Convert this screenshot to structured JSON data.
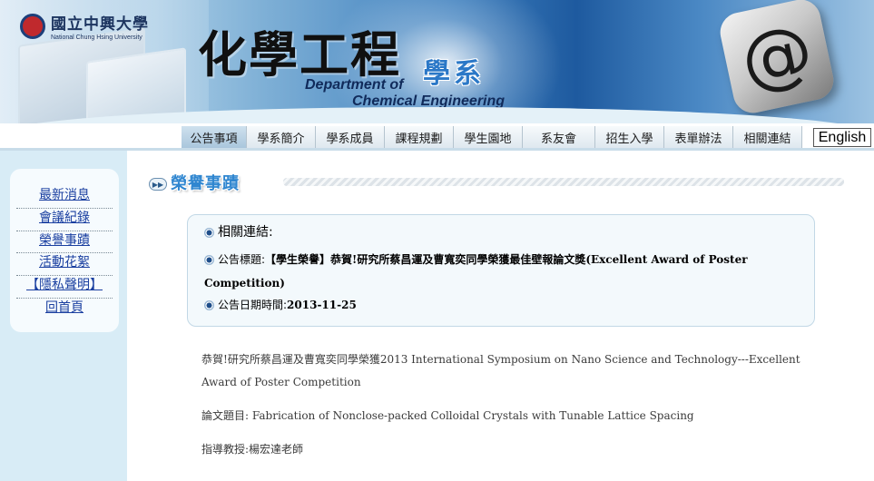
{
  "banner": {
    "university_zh": "國立中興大學",
    "university_en": "National Chung Hsing University",
    "dept_zh": "化學工程",
    "dept_suffix": "學系",
    "dept_en_line1": "Department of",
    "dept_en_line2": "Chemical Engineering",
    "at_symbol": "@"
  },
  "nav": {
    "items": [
      "公告事項",
      "學系簡介",
      "學系成員",
      "課程規劃",
      "學生園地",
      "系友會",
      "招生入學",
      "表單辦法",
      "相關連結"
    ],
    "active_index": 0,
    "english_label": "English"
  },
  "sidebar": {
    "items": [
      "最新消息",
      "會議紀錄",
      "榮譽事蹟",
      "活動花絮",
      "【隱私聲明】",
      "回首頁"
    ]
  },
  "section": {
    "arrow": "▶▶",
    "title": "榮譽事蹟"
  },
  "info": {
    "heading": "相關連結:",
    "title_label": "公告標題:",
    "title_value": "【學生榮譽】恭賀!研究所蔡昌運及曹寬奕同學榮獲最佳壁報論文獎(Excellent Award of Poster Competition)",
    "date_label": "公告日期時間:",
    "date_value": "2013-11-25"
  },
  "article": {
    "para1": "恭賀!研究所蔡昌運及曹寬奕同學榮獲2013 International Symposium on Nano Science and Technology---Excellent Award of Poster Competition",
    "para2": "論文題目: Fabrication of Nonclose-packed Colloidal Crystals with Tunable Lattice Spacing",
    "para3": "指導教授:楊宏達老師"
  }
}
